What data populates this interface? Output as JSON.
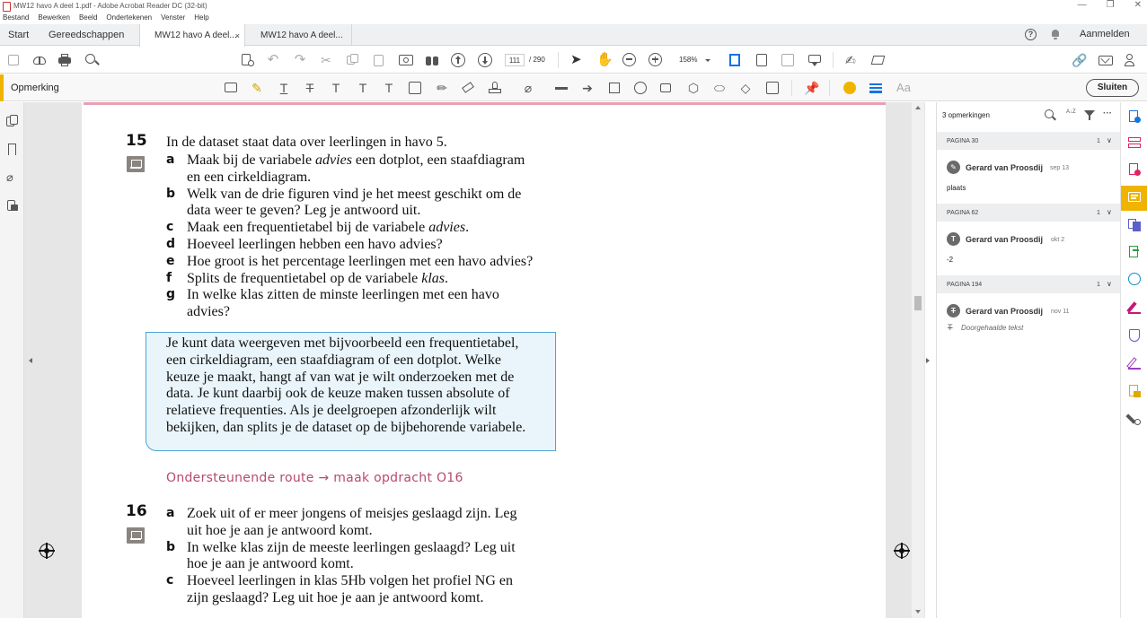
{
  "window": {
    "title": "MW12 havo A deel 1.pdf - Adobe Acrobat Reader DC (32-bit)",
    "minimize": "—",
    "restore": "❐",
    "close": "✕"
  },
  "menubar": [
    "Bestand",
    "Bewerken",
    "Beeld",
    "Ondertekenen",
    "Venster",
    "Help"
  ],
  "tabs": {
    "start": "Start",
    "tools": "Gereedschappen",
    "doc1": "MW12 havo A deel...",
    "doc1_close": "×",
    "doc2": "MW12 havo A deel..."
  },
  "header": {
    "help_icon": "?",
    "signin": "Aanmelden"
  },
  "toolbar": {
    "page_current": "111",
    "page_total": "/ 290",
    "zoom": "158%"
  },
  "commentbar": {
    "label": "Opmerking",
    "text_icon": "Aa",
    "close": "Sluiten"
  },
  "document": {
    "q15": {
      "number": "15",
      "stem": "In de dataset staat data over leerlingen in havo 5.",
      "items": [
        {
          "letter": "a",
          "lines": [
            [
              "Maak bij de variabele ",
              "advies",
              " een dotplot, een staafdiagram"
            ],
            [
              "en een cirkeldiagram."
            ]
          ]
        },
        {
          "letter": "b",
          "lines": [
            [
              "Welk van de drie figuren vind je het meest geschikt om de"
            ],
            [
              "data weer te geven? Leg je antwoord uit."
            ]
          ]
        },
        {
          "letter": "c",
          "lines": [
            [
              "Maak een frequentietabel bij de variabele ",
              "advies",
              "."
            ]
          ]
        },
        {
          "letter": "d",
          "lines": [
            [
              "Hoeveel leerlingen hebben een havo advies?"
            ]
          ]
        },
        {
          "letter": "e",
          "lines": [
            [
              "Hoe groot is het percentage leerlingen met een havo advies?"
            ]
          ]
        },
        {
          "letter": "f",
          "lines": [
            [
              "Splits de frequentietabel op de variabele ",
              "klas",
              "."
            ]
          ]
        },
        {
          "letter": "g",
          "lines": [
            [
              "In welke klas zitten de minste leerlingen met een havo"
            ],
            [
              "advies?"
            ]
          ]
        }
      ]
    },
    "info": [
      "Je kunt data weergeven met bijvoorbeeld een frequentietabel,",
      "een cirkeldiagram, een staafdiagram of een dotplot. Welke",
      "keuze je maakt, hangt af van wat je wilt onderzoeken met de",
      "data. Je kunt daarbij ook de keuze maken tussen absolute of",
      "relatieve frequenties. Als je deelgroepen afzonderlijk wilt",
      "bekijken, dan splits je de dataset op de bijbehorende variabele."
    ],
    "route": "Ondersteunende route → maak opdracht O16",
    "q16": {
      "number": "16",
      "items": [
        {
          "letter": "a",
          "lines": [
            [
              "Zoek uit of er meer jongens of meisjes geslaagd zijn. Leg"
            ],
            [
              "uit hoe je aan je antwoord komt."
            ]
          ]
        },
        {
          "letter": "b",
          "lines": [
            [
              "In welke klas zijn de meeste leerlingen geslaagd? Leg uit"
            ],
            [
              "hoe je aan je antwoord komt."
            ]
          ]
        },
        {
          "letter": "c",
          "lines": [
            [
              "Hoeveel leerlingen in klas 5Hb volgen het profiel NG en"
            ],
            [
              "zijn geslaagd? Leg uit hoe je aan je antwoord komt."
            ]
          ]
        }
      ]
    }
  },
  "comments": {
    "header": "3 opmerkingen",
    "sort_icon": "A↓Z",
    "more": "···",
    "groups": [
      {
        "page": "PAGINA 30",
        "count": "1",
        "chevron": "∨",
        "author": "Gerard van Proosdij",
        "date": "sep 13",
        "text": "plaats"
      },
      {
        "page": "PAGINA 62",
        "count": "1",
        "chevron": "∨",
        "author": "Gerard van Proosdij",
        "date": "okt 2",
        "text": "-2"
      },
      {
        "page": "PAGINA 194",
        "count": "1",
        "chevron": "∨",
        "author": "Gerard van Proosdij",
        "date": "nov 11",
        "text": "Doorgehaalde tekst"
      }
    ]
  },
  "colors": {
    "accent": "#f0b400",
    "route": "#b84a6e",
    "infobox_border": "#49a6d4",
    "infobox_bg": "#eaf5fb"
  }
}
